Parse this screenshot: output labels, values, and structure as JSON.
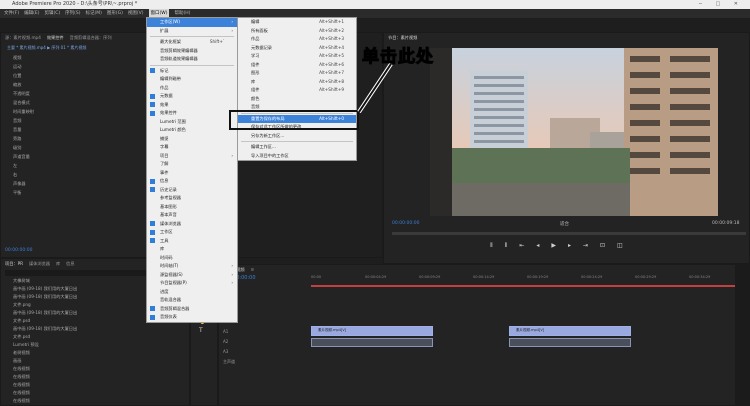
{
  "title_bar": {
    "title": "Adobe Premiere Pro 2020 - D:\\头条号\\PR\\~.prproj *"
  },
  "menubar": [
    "文件(F)",
    "编辑(E)",
    "剪辑(C)",
    "序列(S)",
    "标记(M)",
    "图形(G)",
    "视图(V)",
    "窗口(W)",
    "帮助(H)"
  ],
  "active_menu": "窗口(W)",
  "source_panel": {
    "tabs": [
      "源：素片视频.mp4",
      "效果控件",
      "音频剪辑混合器：序列"
    ],
    "sub": "主要 * 素片视频.mp4  ▶  序列 01 * 素片视频",
    "rows": [
      "视频",
      "运动",
      "位置",
      "缩放",
      "不透明度",
      "混合模式",
      "时间重映射",
      "音频",
      "音量",
      "旁路",
      "级别",
      "声道音量",
      "左",
      "右",
      "声像器",
      "平衡"
    ],
    "timecode": "00:00:00:00"
  },
  "window_menu": {
    "items": [
      {
        "label": "工作区(W)",
        "arrow": true,
        "highlight": true
      },
      {
        "label": "扩展",
        "arrow": true
      },
      {
        "sep": true
      },
      {
        "label": "最大化框架",
        "shortcut": "Shift+`"
      },
      {
        "label": "音频剪辑效果编辑器"
      },
      {
        "label": "音频轨道效果编辑器"
      },
      {
        "sep": true
      },
      {
        "label": "标记",
        "checked": true
      },
      {
        "label": "编辑到磁带"
      },
      {
        "label": "作品"
      },
      {
        "label": "元数据",
        "checked": true
      },
      {
        "label": "效果",
        "checked": true
      },
      {
        "label": "效果控件",
        "checked": true
      },
      {
        "label": "Lumetri 范围"
      },
      {
        "label": "Lumetri 颜色"
      },
      {
        "label": "捕捉"
      },
      {
        "label": "字幕"
      },
      {
        "label": "项目",
        "arrow": true
      },
      {
        "label": "了解"
      },
      {
        "label": "事件"
      },
      {
        "label": "信息",
        "checked": true
      },
      {
        "label": "历史记录",
        "checked": true
      },
      {
        "label": "参考监视器"
      },
      {
        "label": "基本图形"
      },
      {
        "label": "基本声音"
      },
      {
        "label": "媒体浏览器",
        "checked": true
      },
      {
        "label": "工作区",
        "checked": true
      },
      {
        "label": "工具",
        "checked": true
      },
      {
        "label": "库"
      },
      {
        "label": "时间码"
      },
      {
        "label": "时间轴(T)",
        "arrow": true
      },
      {
        "label": "源监视器(S)",
        "arrow": true
      },
      {
        "label": "节目监视器(P)",
        "arrow": true
      },
      {
        "label": "进度"
      },
      {
        "label": "音轨混合器"
      },
      {
        "label": "音频剪辑混合器",
        "checked": true
      },
      {
        "label": "音频仪表",
        "checked": true
      }
    ]
  },
  "workspace_submenu": {
    "items": [
      {
        "label": "编辑",
        "shortcut": "Alt+Shift+1"
      },
      {
        "label": "所有面板",
        "shortcut": "Alt+Shift+2"
      },
      {
        "label": "作品",
        "shortcut": "Alt+Shift+3"
      },
      {
        "label": "元数据记录",
        "shortcut": "Alt+Shift+4"
      },
      {
        "label": "学习",
        "shortcut": "Alt+Shift+5"
      },
      {
        "label": "组件",
        "shortcut": "Alt+Shift+6"
      },
      {
        "label": "图形",
        "shortcut": "Alt+Shift+7"
      },
      {
        "label": "库",
        "shortcut": "Alt+Shift+8"
      },
      {
        "label": "组件",
        "shortcut": "Alt+Shift+9"
      },
      {
        "label": "颜色"
      },
      {
        "label": "音频"
      },
      {
        "sep": true
      },
      {
        "label": "重置为保存的布局",
        "shortcut": "Alt+Shift+0",
        "highlight": true
      },
      {
        "label": "保存对此工作区所做的更改"
      },
      {
        "label": "另存为新工作区..."
      },
      {
        "sep": true
      },
      {
        "label": "编辑工作区..."
      },
      {
        "label": "导入项目中的工作区"
      }
    ]
  },
  "annotation": {
    "text": "单击此处"
  },
  "program_monitor": {
    "title": "节目：素片视频",
    "timecode_left": "00:00:00:00",
    "fit": "适合",
    "timecode_right": "00:00:09:18"
  },
  "project_panel": {
    "tabs": [
      "项目：PR",
      "媒体浏览器",
      "库",
      "信息"
    ],
    "items": [
      "大橡树城",
      "画中画 (09-18) 我们用的大厦日出",
      "画中画 (09-18) 我们用的大厦日出",
      "文件.png",
      "画中画 (09-18) 我们用的大厦日出",
      "文件.psd",
      "画中画 (09-18) 我们用的大厦日出",
      "文件.psd",
      "Lumetri 预设",
      "老树视频",
      "画画",
      "在线视频",
      "在线视频",
      "在线视频",
      "在线视频",
      "在线视频"
    ]
  },
  "timeline": {
    "tabs": [
      "×  素片视频",
      "≡"
    ],
    "timecode": "00:00:00:00",
    "ruler": [
      "00:00",
      "00:00:04:29",
      "00:00:09:29",
      "00:00:14:29",
      "00:00:19:29",
      "00:00:24:29",
      "00:00:29:29",
      "00:00:34:29",
      "00:00:39:29"
    ],
    "tracks": [
      "V3",
      "V2",
      "V1",
      "A1",
      "A2",
      "A3",
      "主声道"
    ],
    "clip1": "素片视频.mp4[V]",
    "clip2": "素片视频.mp4[V]"
  }
}
